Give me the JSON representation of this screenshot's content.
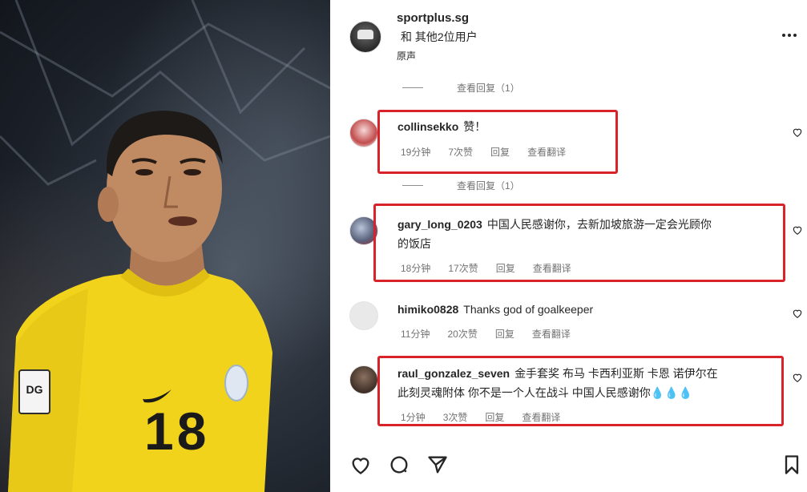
{
  "post": {
    "author": "sportplus.sg",
    "collab_text": "和 其他2位用户",
    "audio_label": "原声"
  },
  "photo": {
    "jersey_number": "18",
    "badge_text": "DG"
  },
  "view_replies": [
    {
      "label": "查看回复（1）"
    },
    {
      "label": "查看回复（1）"
    }
  ],
  "comments": [
    {
      "username": "collinsekko",
      "text": "赞！",
      "time": "19分钟",
      "likes": "7次赞",
      "reply": "回复",
      "translate": "查看翻译",
      "highlighted": true
    },
    {
      "username": "gary_long_0203",
      "text": "中国人民感谢你，去新加坡旅游一定会光顾你",
      "text_line2": "的饭店",
      "time": "18分钟",
      "likes": "17次赞",
      "reply": "回复",
      "translate": "查看翻译",
      "highlighted": true
    },
    {
      "username": "himiko0828",
      "text": "Thanks god of goalkeeper",
      "time": "11分钟",
      "likes": "20次赞",
      "reply": "回复",
      "translate": "查看翻译",
      "highlighted": false
    },
    {
      "username": "raul_gonzalez_seven",
      "text": "金手套奖 布马 卡西利亚斯 卡恩 诺伊尔在",
      "text_line2": "此刻灵魂附体 你不是一个人在战斗 中国人民感谢你💧💧💧",
      "time": "1分钟",
      "likes": "3次赞",
      "reply": "回复",
      "translate": "查看翻译",
      "highlighted": true
    }
  ],
  "colors": {
    "highlight": "#d8232a",
    "jersey": "#f2d31c",
    "text": "#262626",
    "meta": "#737373"
  },
  "icons": [
    "more-icon",
    "heart-icon",
    "comment-icon",
    "share-icon",
    "bookmark-icon"
  ]
}
